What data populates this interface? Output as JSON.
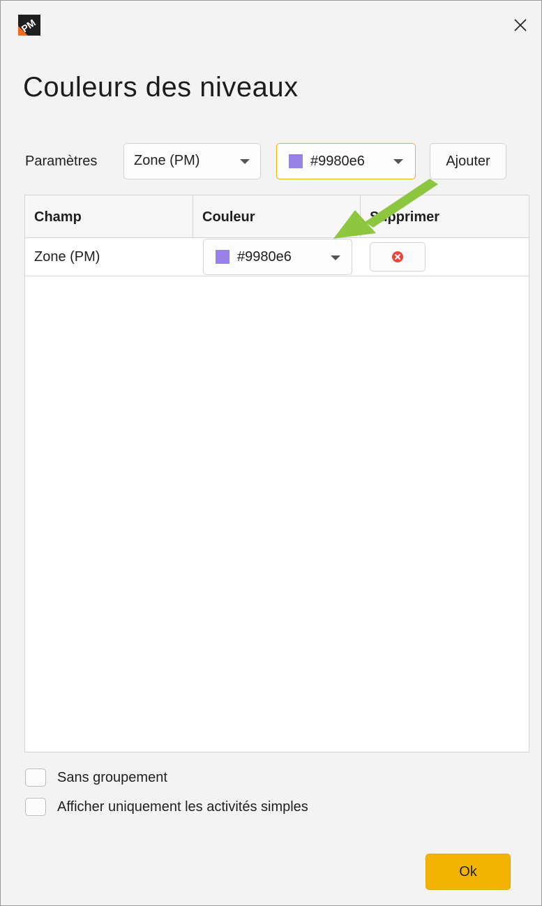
{
  "window": {
    "app_icon": "pm-app-icon",
    "close_symbol": "✕"
  },
  "title": "Couleurs des niveaux",
  "params": {
    "label": "Paramètres",
    "field_select": "Zone (PM)",
    "color_select": {
      "value": "#9980e6",
      "swatch": "#9980e6"
    },
    "add_label": "Ajouter"
  },
  "grid": {
    "columns": [
      "Champ",
      "Couleur",
      "Supprimer"
    ],
    "rows": [
      {
        "champ": "Zone (PM)",
        "couleur": "#9980e6",
        "swatch": "#9980e6",
        "delete_icon": "delete-x-icon"
      }
    ]
  },
  "options": {
    "no_grouping": {
      "label": "Sans groupement",
      "checked": false
    },
    "simple_only": {
      "label": "Afficher uniquement les activités simples",
      "checked": false
    }
  },
  "ok_label": "Ok",
  "colors": {
    "accent": "#f2b400",
    "arrow": "#8dc63f",
    "delete_red": "#e8453c"
  }
}
